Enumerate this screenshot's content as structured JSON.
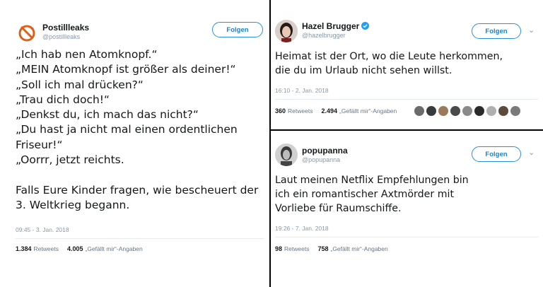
{
  "tweets": [
    {
      "name": "Postillleaks",
      "handle": "@postillleaks",
      "follow_label": "Folgen",
      "lines": [
        "„Ich hab nen Atomknopf.“",
        "„MEIN Atomknopf ist größer als deiner!“",
        "„Soll ich mal drücken?“",
        "„Trau dich doch!“",
        "„Denkst du, ich mach das nicht?“",
        "„Du hast ja nicht mal einen ordentlichen",
        "Friseur!“",
        "„Oorrr, jetzt reichts.",
        "",
        "Falls Eure Kinder fragen, wie bescheuert der",
        "3. Weltkrieg begann."
      ],
      "timestamp": "09:45 - 3. Jan. 2018",
      "retweets_count": "1.384",
      "retweets_label": "Retweets",
      "likes_count": "4.005",
      "likes_label": "„Gefällt mir“-Angaben"
    },
    {
      "name": "Hazel Brugger",
      "handle": "@hazelbrugger",
      "verified": true,
      "follow_label": "Folgen",
      "menu_icon": "chevron-down-icon",
      "lines": [
        "Heimat ist der Ort, wo die Leute herkommen,",
        "die du im Urlaub nicht sehen willst."
      ],
      "timestamp": "16:10 - 2. Jan. 2018",
      "retweets_count": "360",
      "retweets_label": "Retweets",
      "likes_count": "2.494",
      "likes_label": "„Gefällt mir“-Angaben",
      "liker_colors": [
        "#6b6b6b",
        "#3a3a3a",
        "#9a7a5a",
        "#4a4a4a",
        "#8a8a8a",
        "#2a2a2a",
        "#b0b0b0",
        "#5a4a3a",
        "#7a7a7a"
      ]
    },
    {
      "name": "popupanna",
      "handle": "@popupanna",
      "follow_label": "Folgen",
      "menu_icon": "chevron-down-icon",
      "lines": [
        "Laut meinen Netflix Empfehlungen bin",
        "ich ein romantischer Axtmörder mit",
        "Vorliebe für Raumschiffe."
      ],
      "timestamp": "19:26 - 7. Jan. 2018",
      "retweets_count": "98",
      "retweets_label": "Retweets",
      "likes_count": "758",
      "likes_label": "„Gefällt mir“-Angaben"
    }
  ],
  "colors": {
    "accent": "#1b84c8",
    "verified": "#1da1f2",
    "secondary_text": "#8899a6"
  }
}
